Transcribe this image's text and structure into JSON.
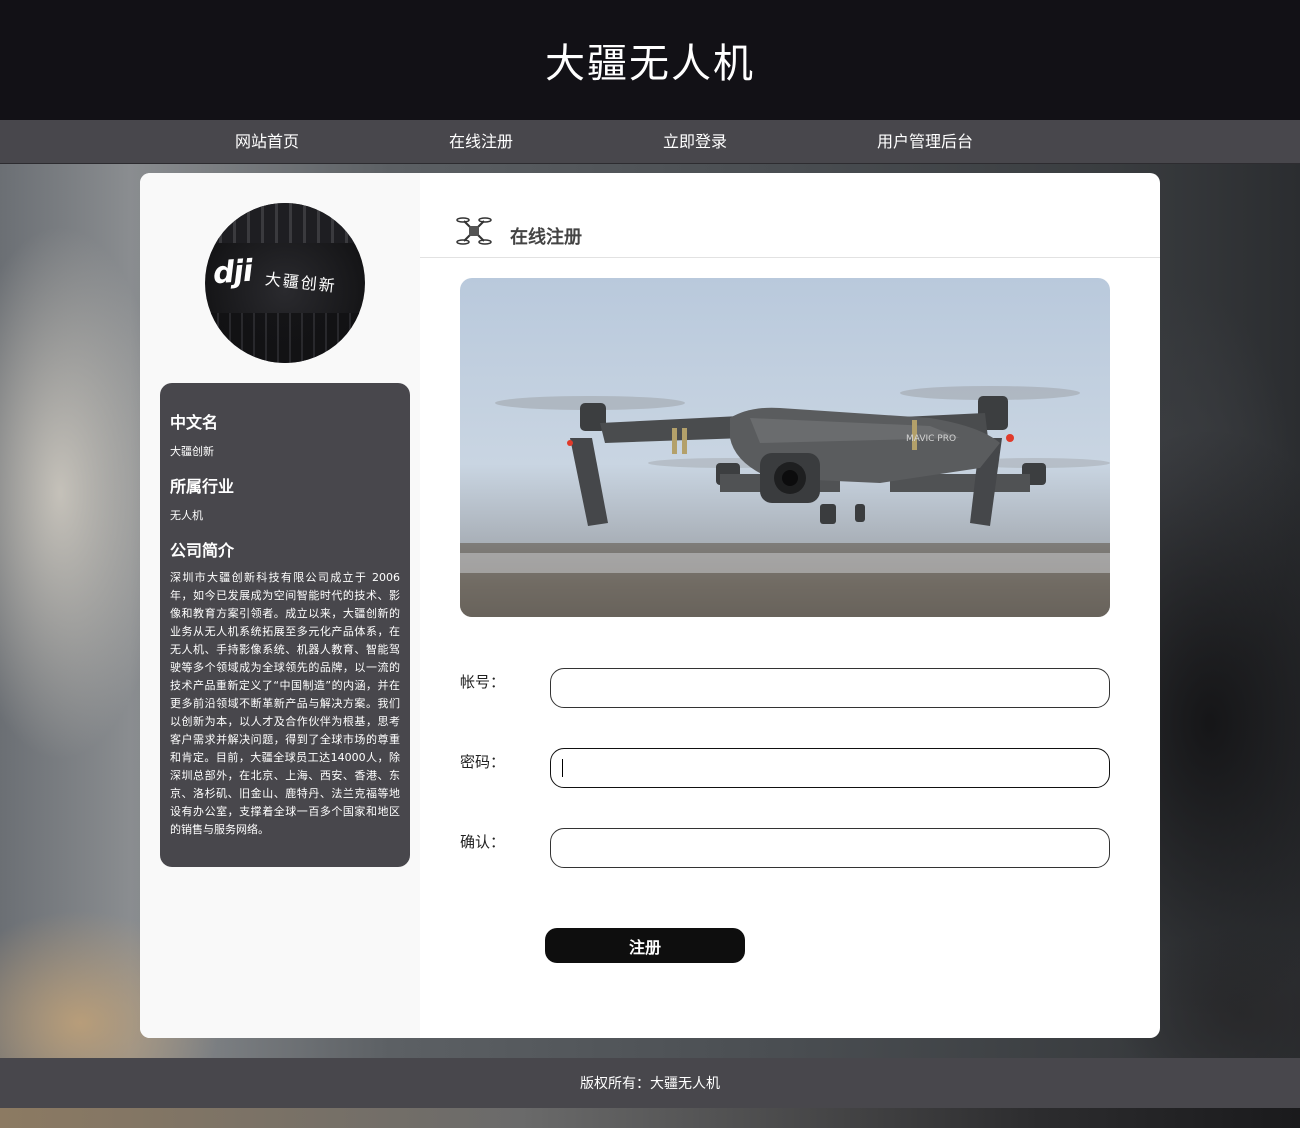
{
  "header": {
    "title": "大疆无人机"
  },
  "nav": {
    "items": [
      "网站首页",
      "在线注册",
      "立即登录",
      "用户管理后台"
    ]
  },
  "sidebar": {
    "avatar_logo": "dji",
    "avatar_cn": "大疆创新",
    "sections": [
      {
        "heading": "中文名",
        "value": "大疆创新"
      },
      {
        "heading": "所属行业",
        "value": "无人机"
      },
      {
        "heading": "公司简介",
        "value": "深圳市大疆创新科技有限公司成立于 2006 年，如今已发展成为空间智能时代的技术、影像和教育方案引领者。成立以来，大疆创新的业务从无人机系统拓展至多元化产品体系，在无人机、手持影像系统、机器人教育、智能驾驶等多个领域成为全球领先的品牌，以一流的技术产品重新定义了“中国制造”的内涵，并在更多前沿领域不断革新产品与解决方案。我们以创新为本，以人才及合作伙伴为根基，思考客户需求并解决问题，得到了全球市场的尊重和肯定。目前，大疆全球员工达14000人，除深圳总部外，在北京、上海、西安、香港、东京、洛杉矶、旧金山、鹿特丹、法兰克福等地设有办公室，支撑着全球一百多个国家和地区的销售与服务网络。"
      }
    ]
  },
  "main": {
    "section_title": "在线注册",
    "banner_brand": "MAVIC PRO",
    "form": {
      "account_label": "帐号：",
      "account_value": "",
      "password_label": "密码：",
      "password_value": "",
      "confirm_label": "确认：",
      "confirm_value": "",
      "submit_label": "注册"
    }
  },
  "footer": {
    "text": "版权所有：大疆无人机"
  },
  "colors": {
    "header": "#121116",
    "nav": "#48474c",
    "panel": "#48474c",
    "button": "#0e0e0e"
  }
}
